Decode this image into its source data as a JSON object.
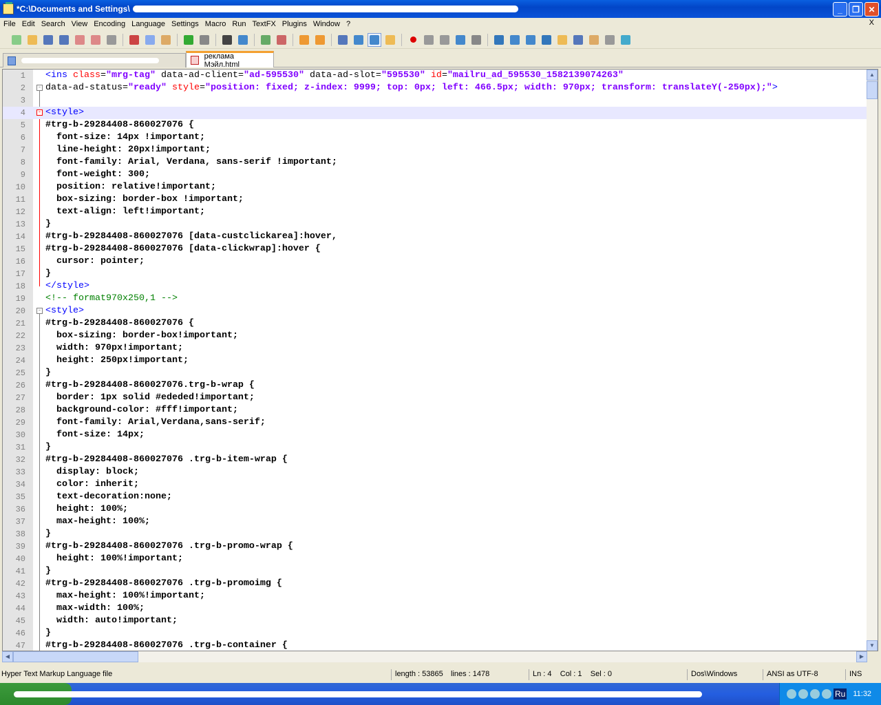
{
  "window": {
    "title": "*C:\\Documents and Settings\\"
  },
  "menu": [
    "File",
    "Edit",
    "Search",
    "View",
    "Encoding",
    "Language",
    "Settings",
    "Macro",
    "Run",
    "TextFX",
    "Plugins",
    "Window",
    "?"
  ],
  "menu_close": "X",
  "toolbar": [
    "new-file",
    "open-file",
    "save",
    "save-all",
    "close",
    "close-all",
    "print",
    "cut",
    "copy",
    "paste",
    "undo",
    "redo",
    "find",
    "replace",
    "zoom-in",
    "zoom-out",
    "sync-vertical",
    "sync-horizontal",
    "word-wrap",
    "show-all-chars",
    "indent-guide",
    "user-language",
    "record-macro",
    "stop-macro",
    "play-macro",
    "run-macro-multiple",
    "save-macro",
    "first",
    "prev",
    "next",
    "last",
    "folder",
    "console",
    "doc-map",
    "function-list",
    "spellcheck"
  ],
  "tabs": [
    {
      "label": ""
    },
    {
      "label": "реклама Мэйл.html",
      "active": true
    }
  ],
  "editor": {
    "current_line": 4,
    "lines": [
      [
        [
          "t",
          "<ins "
        ],
        [
          "a",
          "class"
        ],
        [
          "p",
          "="
        ],
        [
          "v",
          "\"mrg-tag\""
        ],
        [
          "p",
          " data-ad-client="
        ],
        [
          "v",
          "\"ad-595530\""
        ],
        [
          "p",
          " data-ad-slot="
        ],
        [
          "v",
          "\"595530\""
        ],
        [
          "p",
          " "
        ],
        [
          "a",
          "id"
        ],
        [
          "p",
          "="
        ],
        [
          "v",
          "\"mailru_ad_595530_1582139074263\""
        ]
      ],
      [
        [
          "p",
          "data-ad-status="
        ],
        [
          "v",
          "\"ready\""
        ],
        [
          "p",
          " "
        ],
        [
          "a",
          "style"
        ],
        [
          "p",
          "="
        ],
        [
          "v",
          "\"position: fixed; z-index: 9999; top: 0px; left: 466.5px; width: 970px; transform: translateY(-250px);\""
        ],
        [
          "t",
          ">"
        ]
      ],
      [],
      [
        [
          "t",
          "<style>"
        ]
      ],
      [
        [
          "c",
          "#trg-b-29284408-860027076 {"
        ]
      ],
      [
        [
          "c",
          "  font-size: 14px !important;"
        ]
      ],
      [
        [
          "c",
          "  line-height: 20px!important;"
        ]
      ],
      [
        [
          "c",
          "  font-family: Arial, Verdana, sans-serif !important;"
        ]
      ],
      [
        [
          "c",
          "  font-weight: 300;"
        ]
      ],
      [
        [
          "c",
          "  position: relative!important;"
        ]
      ],
      [
        [
          "c",
          "  box-sizing: border-box !important;"
        ]
      ],
      [
        [
          "c",
          "  text-align: left!important;"
        ]
      ],
      [
        [
          "c",
          "}"
        ]
      ],
      [
        [
          "c",
          "#trg-b-29284408-860027076 [data-custclickarea]:hover,"
        ]
      ],
      [
        [
          "c",
          "#trg-b-29284408-860027076 [data-clickwrap]:hover {"
        ]
      ],
      [
        [
          "c",
          "  cursor: pointer;"
        ]
      ],
      [
        [
          "c",
          "}"
        ]
      ],
      [
        [
          "t",
          "</style>"
        ]
      ],
      [
        [
          "m",
          "<!-- format970x250,1 -->"
        ]
      ],
      [
        [
          "t",
          "<style>"
        ]
      ],
      [
        [
          "c",
          "#trg-b-29284408-860027076 {"
        ]
      ],
      [
        [
          "c",
          "  box-sizing: border-box!important;"
        ]
      ],
      [
        [
          "c",
          "  width: 970px!important;"
        ]
      ],
      [
        [
          "c",
          "  height: 250px!important;"
        ]
      ],
      [
        [
          "c",
          "}"
        ]
      ],
      [
        [
          "c",
          "#trg-b-29284408-860027076.trg-b-wrap {"
        ]
      ],
      [
        [
          "c",
          "  border: 1px solid #ededed!important;"
        ]
      ],
      [
        [
          "c",
          "  background-color: #fff!important;"
        ]
      ],
      [
        [
          "c",
          "  font-family: Arial,Verdana,sans-serif;"
        ]
      ],
      [
        [
          "c",
          "  font-size: 14px;"
        ]
      ],
      [
        [
          "c",
          "}"
        ]
      ],
      [
        [
          "c",
          "#trg-b-29284408-860027076 .trg-b-item-wrap {"
        ]
      ],
      [
        [
          "c",
          "  display: block;"
        ]
      ],
      [
        [
          "c",
          "  color: inherit;"
        ]
      ],
      [
        [
          "c",
          "  text-decoration:none;"
        ]
      ],
      [
        [
          "c",
          "  height: 100%;"
        ]
      ],
      [
        [
          "c",
          "  max-height: 100%;"
        ]
      ],
      [
        [
          "c",
          "}"
        ]
      ],
      [
        [
          "c",
          "#trg-b-29284408-860027076 .trg-b-promo-wrap {"
        ]
      ],
      [
        [
          "c",
          "  height: 100%!important;"
        ]
      ],
      [
        [
          "c",
          "}"
        ]
      ],
      [
        [
          "c",
          "#trg-b-29284408-860027076 .trg-b-promoimg {"
        ]
      ],
      [
        [
          "c",
          "  max-height: 100%!important;"
        ]
      ],
      [
        [
          "c",
          "  max-width: 100%;"
        ]
      ],
      [
        [
          "c",
          "  width: auto!important;"
        ]
      ],
      [
        [
          "c",
          "}"
        ]
      ],
      [
        [
          "c",
          "#trg-b-29284408-860027076 .trg-b-container {"
        ]
      ]
    ]
  },
  "status": {
    "filetype": "Hyper Text Markup Language file",
    "length": "length : 53865",
    "lines": "lines : 1478",
    "pos": "Ln : 4    Col : 1    Sel : 0",
    "eol": "Dos\\Windows",
    "encoding": "ANSI as UTF-8",
    "mode": "INS"
  },
  "taskbar": {
    "lang": "Ru",
    "clock": "11:32"
  }
}
